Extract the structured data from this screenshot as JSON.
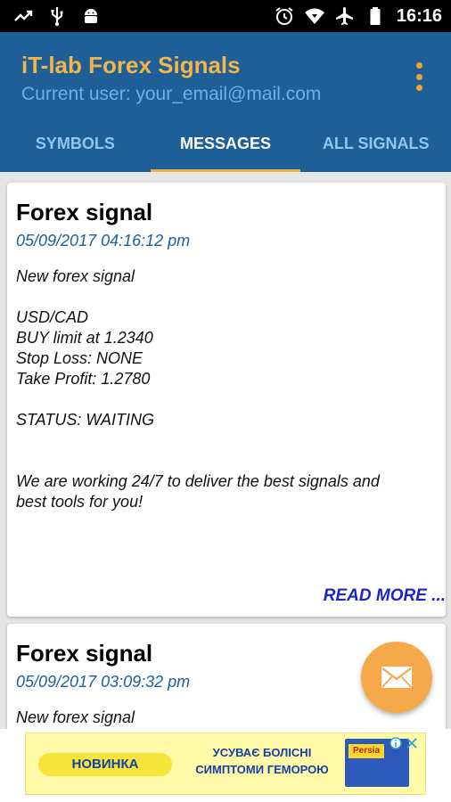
{
  "status_bar": {
    "time": "16:16",
    "left_icons": [
      "trend-icon",
      "usb-icon",
      "android-icon"
    ],
    "right_icons": [
      "alarm-icon",
      "wifi-icon",
      "airplane-icon",
      "battery-icon"
    ]
  },
  "app_bar": {
    "title": "iT-lab Forex Signals",
    "user": "Current user: your_email@mail.com",
    "menu_icon": "overflow-menu-icon"
  },
  "tabs": [
    {
      "label": "SYMBOLS",
      "active": false
    },
    {
      "label": "MESSAGES",
      "active": true
    },
    {
      "label": "ALL SIGNALS",
      "active": false
    }
  ],
  "messages": [
    {
      "title": "Forex signal",
      "date": "05/09/2017 04:16:12 pm",
      "body": [
        "New forex signal",
        "",
        "USD/CAD",
        "BUY limit at 1.2340",
        "Stop Loss: NONE",
        "Take Profit: 1.2780",
        "",
        "STATUS: WAITING",
        "",
        "",
        "We are working 24/7 to deliver the best signals and",
        "best tools for you!"
      ],
      "read_more": "READ MORE ..."
    },
    {
      "title": "Forex signal",
      "date": "05/09/2017 03:09:32 pm",
      "body": [
        "New forex signal"
      ]
    }
  ],
  "fab": {
    "icon": "mail-icon"
  },
  "ad": {
    "badge": "НОВИНКА",
    "text_line1": "УСУВАЄ БОЛІСНІ",
    "text_line2": "СИМПТОМИ ГЕМОРОЮ",
    "product_label": "Persia",
    "colors": {
      "background": "#fff9a8",
      "accent": "#1440a8"
    }
  },
  "colors": {
    "primary": "#1d5f96",
    "accent": "#f0b040",
    "fab": "#f6a94b",
    "link": "#1f24c9"
  }
}
